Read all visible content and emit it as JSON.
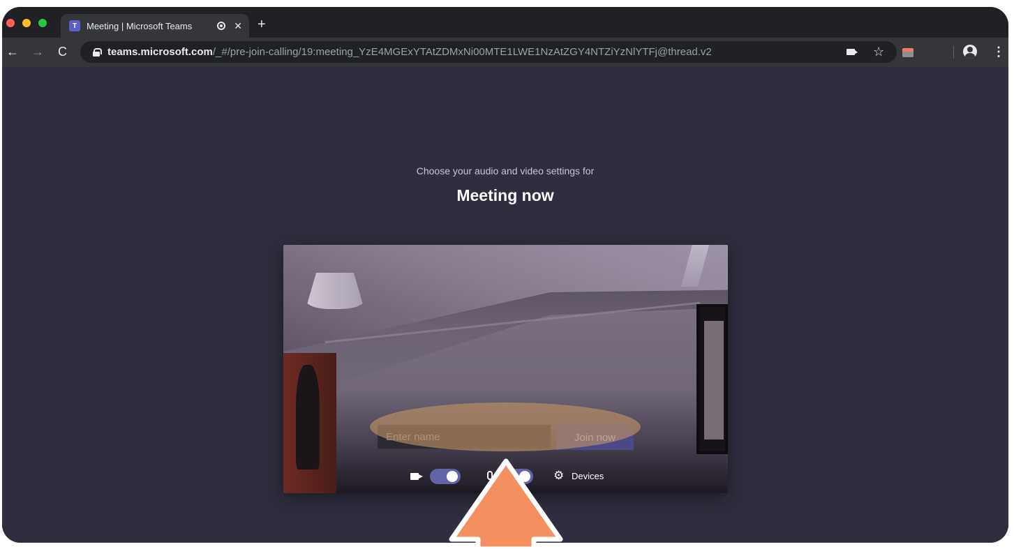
{
  "browser": {
    "tab": {
      "favicon": "T",
      "title": "Meeting | Microsoft Teams",
      "close": "✕",
      "new_tab": "+"
    },
    "nav": {
      "back": "←",
      "forward": "→",
      "reload": "C"
    },
    "url": {
      "host": "teams.microsoft.com",
      "path": "/_#/pre-join-calling/19:meeting_YzE4MGExYTAtZDMxNi00MTE1LWE1NzAtZGY4NTZiYzNlYTFj@thread.v2"
    },
    "star": "☆",
    "menu": "⋮"
  },
  "prejoin": {
    "subtitle": "Choose your audio and video settings for",
    "title": "Meeting now",
    "name_placeholder": "Enter name",
    "join_label": "Join now",
    "camera_on": true,
    "mic_on": true,
    "devices_label": "Devices",
    "gear": "⚙"
  },
  "colors": {
    "accent": "#6264a7",
    "page_bg": "#2e2e3e",
    "highlight": "#c49566",
    "arrow": "#f4905f"
  },
  "icons": [
    "teams-favicon-icon",
    "lock-icon",
    "camera-icon",
    "star-icon",
    "extension-icon",
    "profile-icon",
    "menu-icon",
    "video-camera-icon",
    "microphone-icon",
    "gear-icon",
    "up-arrow-icon"
  ]
}
